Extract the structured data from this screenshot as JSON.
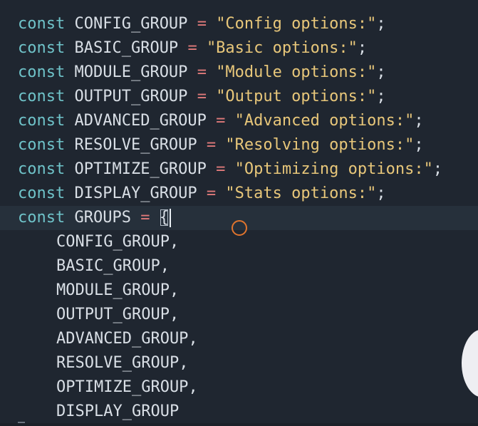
{
  "editor": {
    "keyword": "const",
    "assign": "=",
    "semicolon": ";",
    "open_brace": "{",
    "comma": ",",
    "declarations": [
      {
        "name": "CONFIG_GROUP",
        "value": "\"Config options:\""
      },
      {
        "name": "BASIC_GROUP",
        "value": "\"Basic options:\""
      },
      {
        "name": "MODULE_GROUP",
        "value": "\"Module options:\""
      },
      {
        "name": "OUTPUT_GROUP",
        "value": "\"Output options:\""
      },
      {
        "name": "ADVANCED_GROUP",
        "value": "\"Advanced options:\""
      },
      {
        "name": "RESOLVE_GROUP",
        "value": "\"Resolving options:\""
      },
      {
        "name": "OPTIMIZE_GROUP",
        "value": "\"Optimizing options:\""
      },
      {
        "name": "DISPLAY_GROUP",
        "value": "\"Stats options:\""
      }
    ],
    "groups_decl": {
      "name": "GROUPS"
    },
    "group_members": [
      "CONFIG_GROUP",
      "BASIC_GROUP",
      "MODULE_GROUP",
      "OUTPUT_GROUP",
      "ADVANCED_GROUP",
      "RESOLVE_GROUP",
      "OPTIMIZE_GROUP",
      "DISPLAY_GROUP"
    ]
  },
  "colors": {
    "background": "#1f2630",
    "keyword": "#6fc3c9",
    "identifier": "#d9dfe6",
    "operator": "#e07a7a",
    "string": "#e8c77a",
    "cursor_ring": "#e0742d"
  }
}
